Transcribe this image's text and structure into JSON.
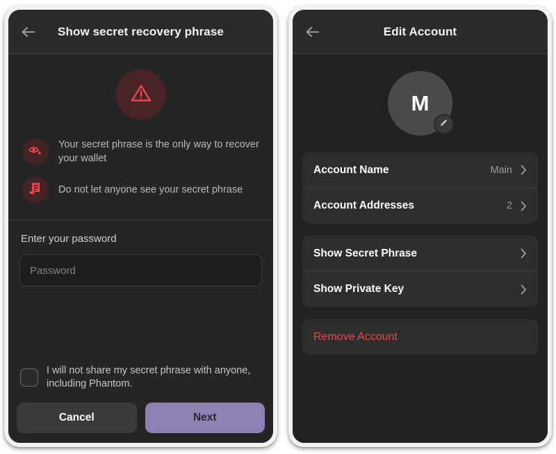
{
  "theme": {
    "screen_bg": "#222222",
    "header_bg": "#2b2b2b",
    "card_bg": "#2e2e2e",
    "accent_purple": "#8b81b5",
    "danger_red": "#e8484a",
    "warn_icon_bg": "#432427",
    "hero_circle_bg": "#4a2326"
  },
  "left_panel": {
    "header": {
      "title": "Show secret recovery phrase",
      "back_icon": "arrow-left-icon"
    },
    "hero_icon": "warning-triangle-icon",
    "warnings": [
      {
        "icon": "eye-warning-icon",
        "text": "Your secret phrase is the only way to recover your wallet"
      },
      {
        "icon": "scroll-document-icon",
        "text": "Do not let anyone see your secret phrase"
      }
    ],
    "password": {
      "label": "Enter your password",
      "placeholder": "Password",
      "value": ""
    },
    "consent": {
      "checked": false,
      "text": "I will not share my secret phrase with anyone, including Phantom."
    },
    "buttons": {
      "cancel": "Cancel",
      "next": "Next"
    }
  },
  "right_panel": {
    "header": {
      "title": "Edit Account",
      "back_icon": "arrow-left-icon"
    },
    "avatar": {
      "letter": "M",
      "edit_icon": "pencil-icon"
    },
    "groups": [
      {
        "rows": [
          {
            "label": "Account Name",
            "value": "Main",
            "chevron": "chevron-right-icon",
            "danger": false
          },
          {
            "label": "Account Addresses",
            "value": "2",
            "chevron": "chevron-right-icon",
            "danger": false
          }
        ]
      },
      {
        "rows": [
          {
            "label": "Show Secret Phrase",
            "value": "",
            "chevron": "chevron-right-icon",
            "danger": false
          },
          {
            "label": "Show Private Key",
            "value": "",
            "chevron": "chevron-right-icon",
            "danger": false
          }
        ]
      },
      {
        "rows": [
          {
            "label": "Remove Account",
            "value": "",
            "chevron": "",
            "danger": true
          }
        ]
      }
    ]
  }
}
